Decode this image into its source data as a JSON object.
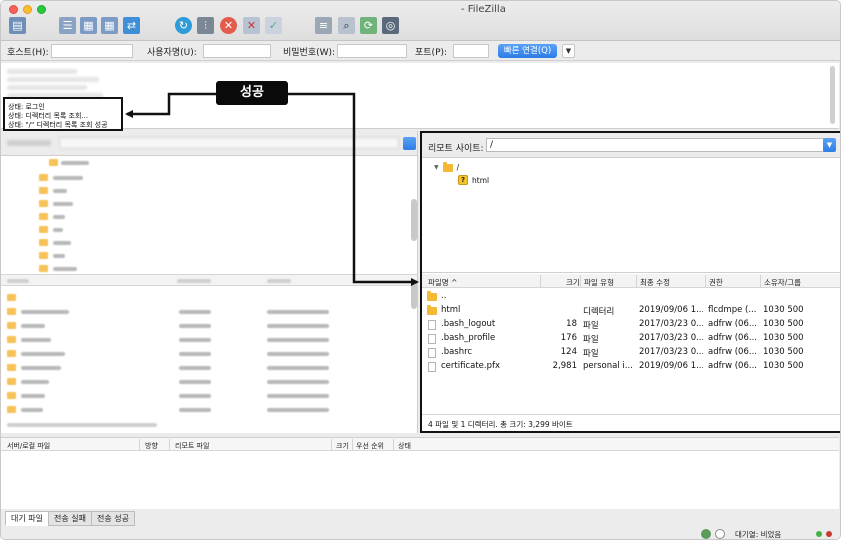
{
  "window": {
    "title": "- FileZilla"
  },
  "quickconnect": {
    "host_label": "호스트(H):",
    "user_label": "사용자명(U):",
    "password_label": "비밀번호(W):",
    "port_label": "포트(P):",
    "connect_label": "빠른 연결(Q)",
    "dropdown_glyph": "▼"
  },
  "log": {
    "lines": [
      "상태:  로그인",
      "상태:  디렉터리 목록 조회...",
      "상태:  \"/\" 디렉터리 목록 조회 성공"
    ]
  },
  "annotation": {
    "badge": "성공"
  },
  "remote": {
    "site_label": "리모트 사이트:",
    "site_path": "/",
    "tree_root": "/",
    "tree_child": "html",
    "columns": {
      "name": "파일명 ^",
      "size": "크기",
      "type": "파일 유형",
      "modified": "최종 수정",
      "perms": "권한",
      "owner": "소유자/그룹"
    },
    "files": [
      {
        "name": "..",
        "size": "",
        "type": "",
        "modified": "",
        "perms": "",
        "owner": "",
        "icon": "folder"
      },
      {
        "name": "html",
        "size": "",
        "type": "디렉터리",
        "modified": "2019/09/06 1...",
        "perms": "flcdmpe (...",
        "owner": "1030 500",
        "icon": "folder"
      },
      {
        "name": ".bash_logout",
        "size": "18",
        "type": "파일",
        "modified": "2017/03/23 0...",
        "perms": "adfrw (06...",
        "owner": "1030 500",
        "icon": "file"
      },
      {
        "name": ".bash_profile",
        "size": "176",
        "type": "파일",
        "modified": "2017/03/23 0...",
        "perms": "adfrw (06...",
        "owner": "1030 500",
        "icon": "file"
      },
      {
        "name": ".bashrc",
        "size": "124",
        "type": "파일",
        "modified": "2017/03/23 0...",
        "perms": "adfrw (06...",
        "owner": "1030 500",
        "icon": "file"
      },
      {
        "name": "certificate.pfx",
        "size": "2,981",
        "type": "personal i...",
        "modified": "2019/09/06 1...",
        "perms": "adfrw (06...",
        "owner": "1030 500",
        "icon": "file"
      }
    ],
    "status": "4 파일 및 1 디렉터리. 총 크기: 3,299 바이트"
  },
  "queue": {
    "columns": {
      "server_file": "서버/로컬 파일",
      "direction": "방향",
      "remote_file": "리모트 파일",
      "size": "크기",
      "priority": "우선 순위",
      "status": "상태"
    },
    "tabs": [
      "대기 파일",
      "전송 실패",
      "전송 성공"
    ]
  },
  "statusbar": {
    "queue_text": "대기열: 비었음"
  },
  "colors": {
    "accent": "#2e7de6",
    "folder": "#f5b836",
    "highlight_border": "#111111"
  }
}
